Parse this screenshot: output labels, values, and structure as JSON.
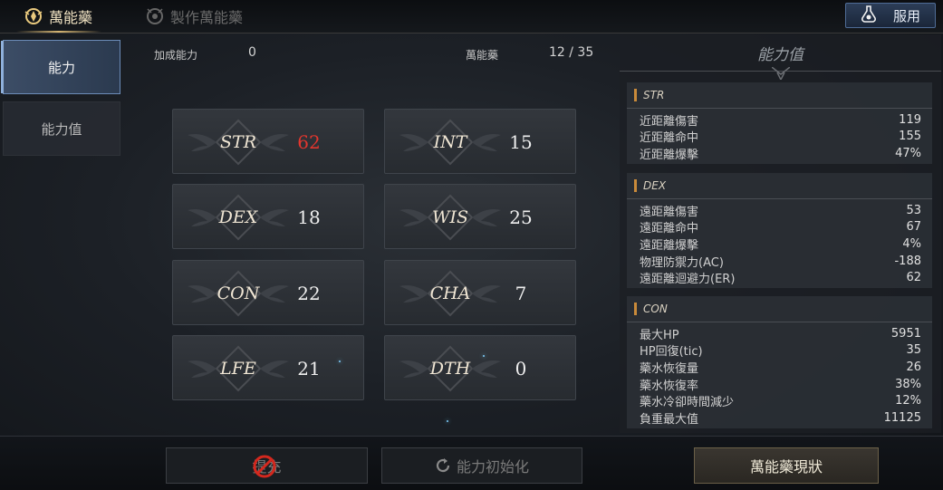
{
  "top_tabs": [
    {
      "label": "萬能藥",
      "icon": "elixir-emblem-icon",
      "active": true
    },
    {
      "label": "製作萬能藥",
      "icon": "crafting-emblem-icon",
      "active": false
    }
  ],
  "use_button": {
    "label": "服用",
    "icon": "potion-flask-icon"
  },
  "left_nav": [
    {
      "label": "能力",
      "active": true
    },
    {
      "label": "能力值",
      "active": false
    }
  ],
  "summary": {
    "bonus_label": "加成能力",
    "bonus_value": "0",
    "elixir_label": "萬能藥",
    "elixir_value": "12 / 35"
  },
  "stats": [
    {
      "name": "STR",
      "value": "62",
      "highlight": "#e2362e"
    },
    {
      "name": "INT",
      "value": "15"
    },
    {
      "name": "DEX",
      "value": "18"
    },
    {
      "name": "WIS",
      "value": "25"
    },
    {
      "name": "CON",
      "value": "22"
    },
    {
      "name": "CHA",
      "value": "7"
    },
    {
      "name": "LFE",
      "value": "21"
    },
    {
      "name": "DTH",
      "value": "0"
    }
  ],
  "right_panel": {
    "title": "能力值",
    "sections": [
      {
        "name": "STR",
        "rows": [
          {
            "label": "近距離傷害",
            "value": "119"
          },
          {
            "label": "近距離命中",
            "value": "155"
          },
          {
            "label": "近距離爆擊",
            "value": "47%"
          }
        ]
      },
      {
        "name": "DEX",
        "rows": [
          {
            "label": "遠距離傷害",
            "value": "53"
          },
          {
            "label": "遠距離命中",
            "value": "67"
          },
          {
            "label": "遠距離爆擊",
            "value": "4%"
          },
          {
            "label": "物理防禦力(AC)",
            "value": "-188"
          },
          {
            "label": "遠距離迴避力(ER)",
            "value": "62"
          }
        ]
      },
      {
        "name": "CON",
        "rows": [
          {
            "label": "最大HP",
            "value": "5951"
          },
          {
            "label": "HP回復(tic)",
            "value": "35"
          },
          {
            "label": "藥水恢復量",
            "value": "26"
          },
          {
            "label": "藥水恢復率",
            "value": "38%"
          },
          {
            "label": "藥水冷卻時間減少",
            "value": "12%"
          },
          {
            "label": "負重最大值",
            "value": "11125"
          }
        ]
      }
    ]
  },
  "bottom_buttons": {
    "confirm_label": "提充",
    "confirm_icon": "forbidden-icon",
    "reset_label": "能力初始化",
    "reset_icon": "refresh-icon",
    "status_label": "萬能藥現狀"
  },
  "colors": {
    "accent_gold": "#d7b672",
    "highlight_red": "#e2362e",
    "nav_active_border": "#6c8cb8"
  }
}
